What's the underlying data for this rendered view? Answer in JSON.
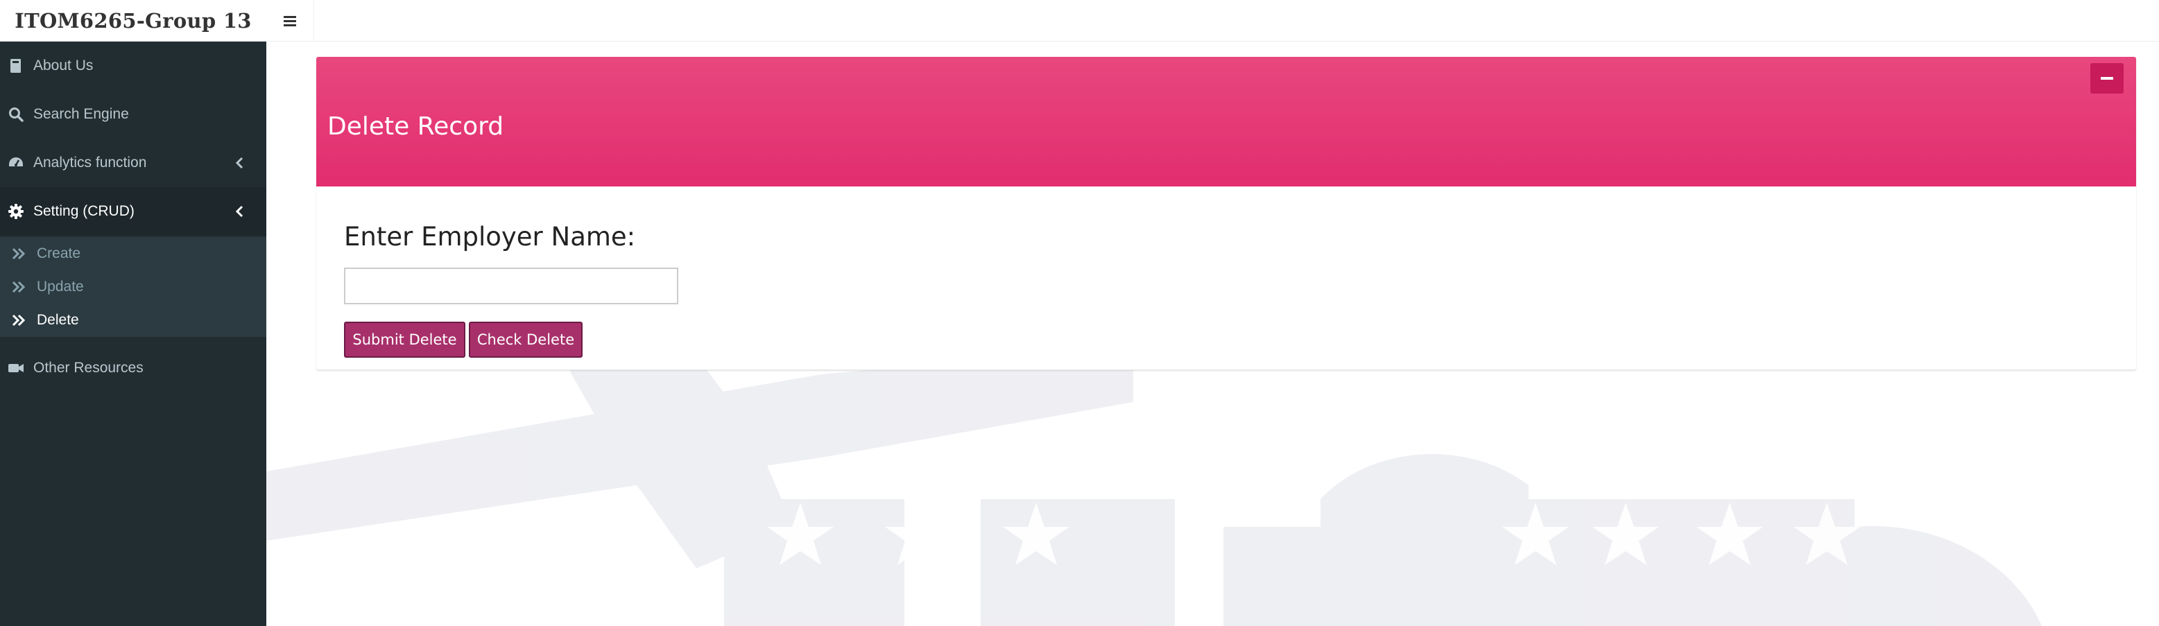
{
  "app": {
    "title": "ITOM6265-Group 13"
  },
  "sidebar": {
    "items": [
      {
        "label": "About Us",
        "icon": "book-icon"
      },
      {
        "label": "Search Engine",
        "icon": "search-icon"
      },
      {
        "label": "Analytics function",
        "icon": "dashboard-icon",
        "expandable": true
      },
      {
        "label": "Setting (CRUD)",
        "icon": "gear-icon",
        "expandable": true,
        "expanded": true
      },
      {
        "label": "Other Resources",
        "icon": "video-icon"
      }
    ],
    "subitems": [
      {
        "label": "Create",
        "icon": "double-chevron-right-icon"
      },
      {
        "label": "Update",
        "icon": "double-chevron-right-icon"
      },
      {
        "label": "Delete",
        "icon": "double-chevron-right-icon",
        "current": true
      }
    ]
  },
  "panel": {
    "title": "Delete Record",
    "field_label": "Enter Employer Name:",
    "input_value": "",
    "input_placeholder": "",
    "submit_label": "Submit Delete",
    "check_label": "Check Delete"
  },
  "colors": {
    "sidebar_bg": "#222d32",
    "sidebar_sub_bg": "#2c3b41",
    "header_pink": "#e22d6e",
    "button_magenta": "#a8306a"
  }
}
